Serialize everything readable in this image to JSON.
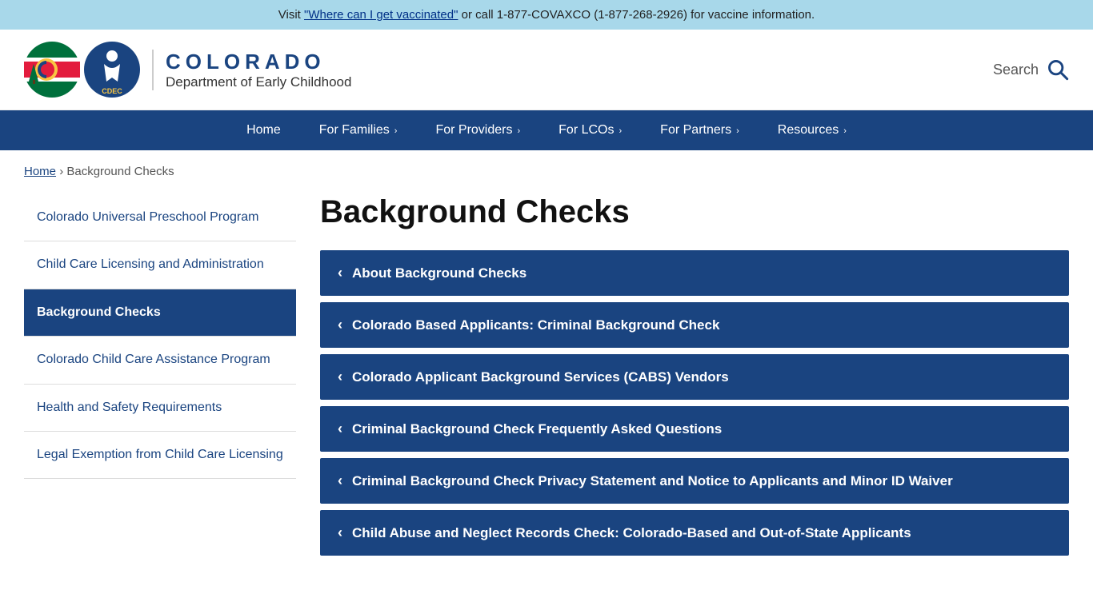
{
  "vaccine_banner": {
    "prefix": "Visit ",
    "link_text": "\"Where can I get vaccinated\"",
    "link_href": "#",
    "suffix": " or call 1-877-COVAXCO (1-877-268-2926) for vaccine information."
  },
  "header": {
    "logo_title": "COLORADO",
    "logo_subtitle": "Department of Early Childhood",
    "search_label": "Search"
  },
  "nav": {
    "items": [
      {
        "label": "Home",
        "has_chevron": false
      },
      {
        "label": "For Families",
        "has_chevron": true
      },
      {
        "label": "For Providers",
        "has_chevron": true
      },
      {
        "label": "For LCOs",
        "has_chevron": true
      },
      {
        "label": "For Partners",
        "has_chevron": true
      },
      {
        "label": "Resources",
        "has_chevron": true
      }
    ]
  },
  "breadcrumb": {
    "home_label": "Home",
    "separator": "›",
    "current": "Background Checks"
  },
  "page_title": "Background Checks",
  "sidebar": {
    "items": [
      {
        "label": "Colorado Universal Preschool Program",
        "active": false
      },
      {
        "label": "Child Care Licensing and Administration",
        "active": false
      },
      {
        "label": "Background Checks",
        "active": true
      },
      {
        "label": "Colorado Child Care Assistance Program",
        "active": false
      },
      {
        "label": "Health and Safety Requirements",
        "active": false
      },
      {
        "label": "Legal Exemption from Child Care Licensing",
        "active": false
      }
    ]
  },
  "accordion": {
    "items": [
      {
        "label": "About Background Checks"
      },
      {
        "label": "Colorado Based Applicants: Criminal Background Check"
      },
      {
        "label": "Colorado Applicant Background Services (CABS) Vendors"
      },
      {
        "label": "Criminal Background Check Frequently Asked Questions"
      },
      {
        "label": "Criminal Background Check Privacy Statement and Notice to Applicants and Minor ID Waiver"
      },
      {
        "label": "Child Abuse and Neglect Records Check: Colorado-Based and Out-of-State Applicants"
      }
    ]
  }
}
